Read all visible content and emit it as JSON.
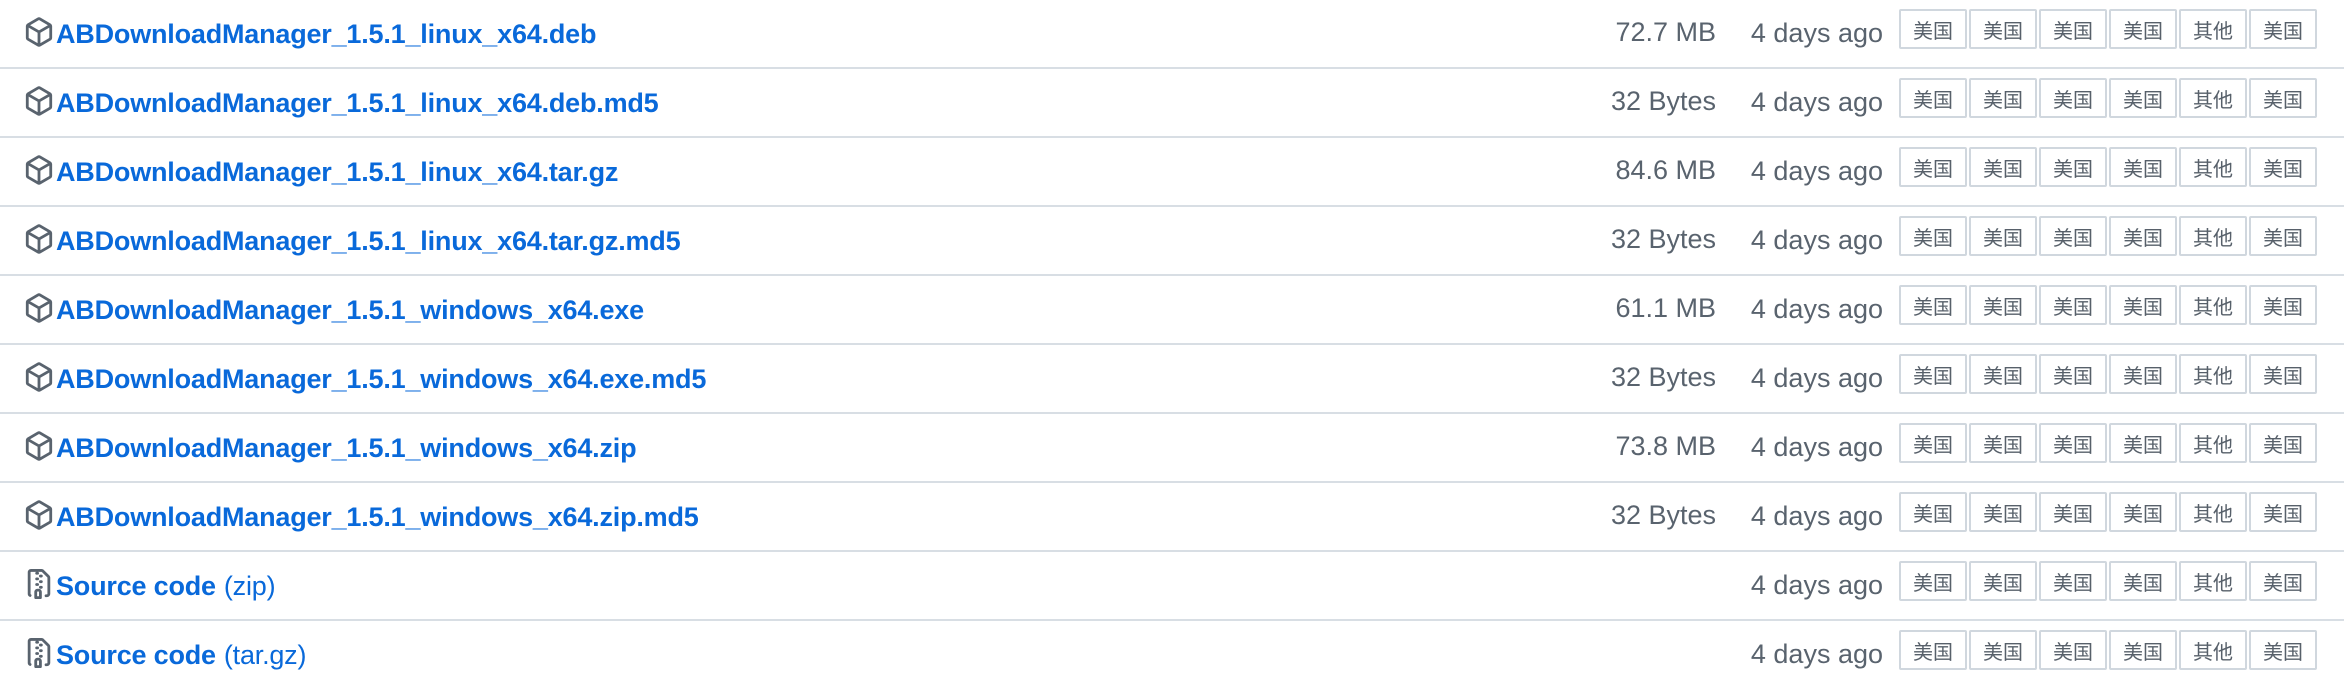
{
  "mirror_labels": [
    "美国",
    "美国",
    "美国",
    "美国",
    "其他",
    "美国"
  ],
  "assets": [
    {
      "name": "ABDownloadManager_1.5.1_linux_x64.deb",
      "suffix": "",
      "size": "72.7 MB",
      "time": "4 days ago",
      "icon": "package-icon"
    },
    {
      "name": "ABDownloadManager_1.5.1_linux_x64.deb.md5",
      "suffix": "",
      "size": "32 Bytes",
      "time": "4 days ago",
      "icon": "package-icon"
    },
    {
      "name": "ABDownloadManager_1.5.1_linux_x64.tar.gz",
      "suffix": "",
      "size": "84.6 MB",
      "time": "4 days ago",
      "icon": "package-icon"
    },
    {
      "name": "ABDownloadManager_1.5.1_linux_x64.tar.gz.md5",
      "suffix": "",
      "size": "32 Bytes",
      "time": "4 days ago",
      "icon": "package-icon"
    },
    {
      "name": "ABDownloadManager_1.5.1_windows_x64.exe",
      "suffix": "",
      "size": "61.1 MB",
      "time": "4 days ago",
      "icon": "package-icon"
    },
    {
      "name": "ABDownloadManager_1.5.1_windows_x64.exe.md5",
      "suffix": "",
      "size": "32 Bytes",
      "time": "4 days ago",
      "icon": "package-icon"
    },
    {
      "name": "ABDownloadManager_1.5.1_windows_x64.zip",
      "suffix": "",
      "size": "73.8 MB",
      "time": "4 days ago",
      "icon": "package-icon"
    },
    {
      "name": "ABDownloadManager_1.5.1_windows_x64.zip.md5",
      "suffix": "",
      "size": "32 Bytes",
      "time": "4 days ago",
      "icon": "package-icon"
    },
    {
      "name": "Source code",
      "suffix": "(zip)",
      "size": "",
      "time": "4 days ago",
      "icon": "file-zip-icon"
    },
    {
      "name": "Source code",
      "suffix": "(tar.gz)",
      "size": "",
      "time": "4 days ago",
      "icon": "file-zip-icon"
    }
  ],
  "colors": {
    "link": "#0969da",
    "muted_text": "#59636e",
    "divider": "#d8dee4",
    "button_border": "#d0d7de"
  }
}
